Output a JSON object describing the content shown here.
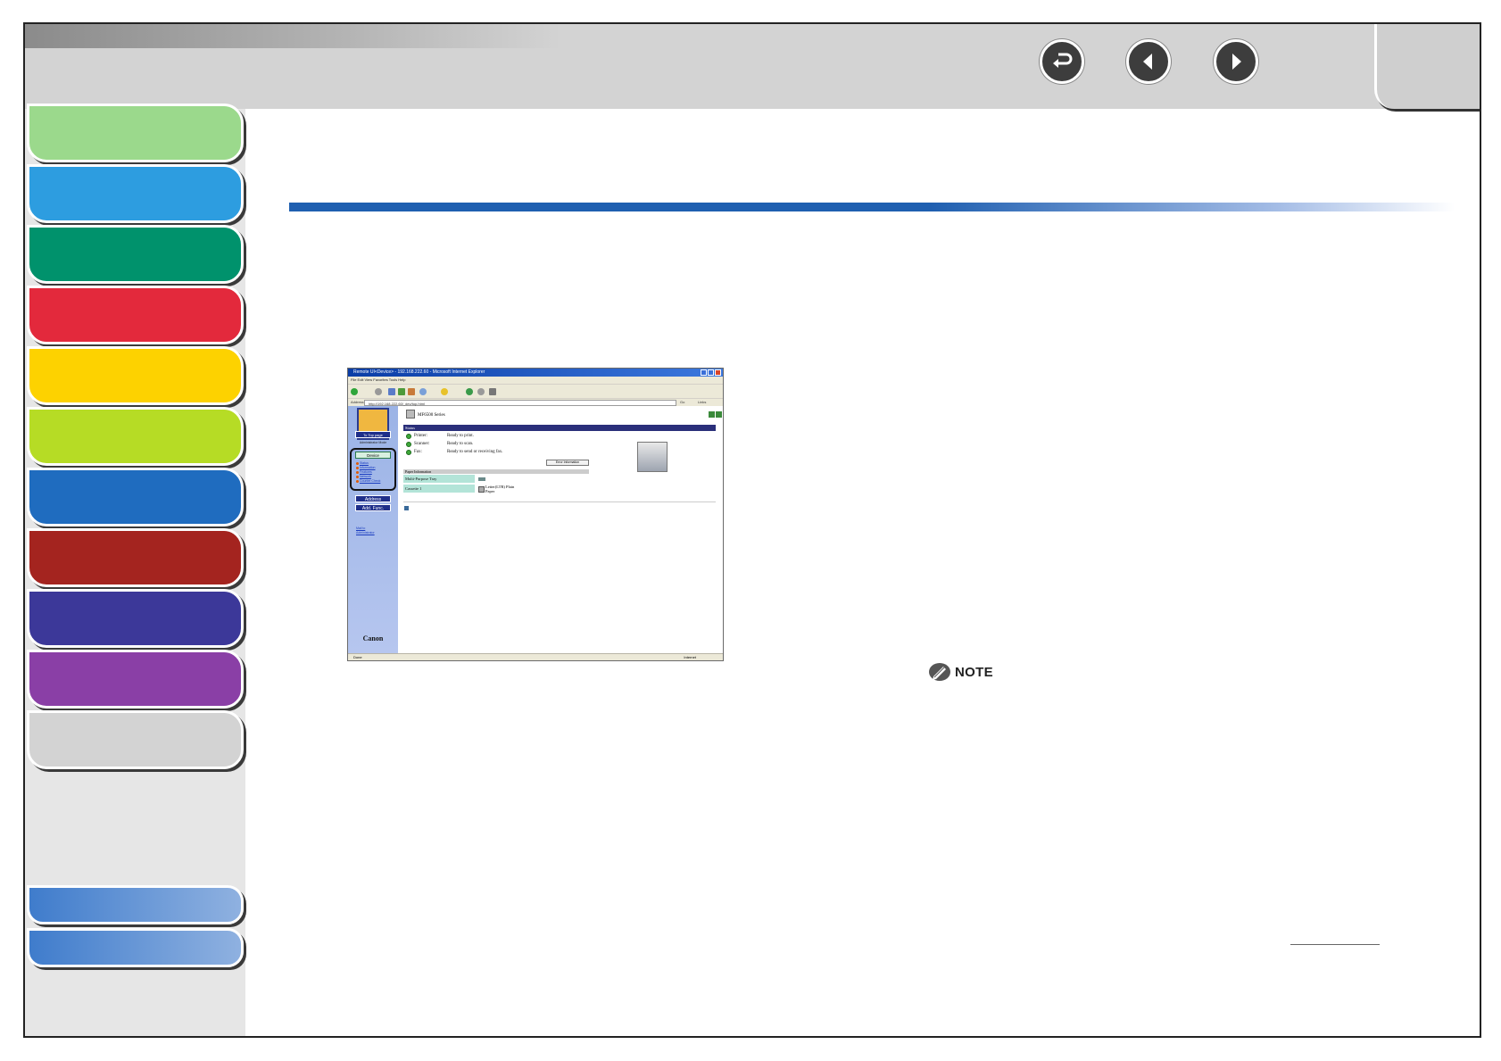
{
  "colors": {
    "chapters": [
      "#9bd98c",
      "#2d9de0",
      "#00926c",
      "#e3293c",
      "#fdd200",
      "#b6dc25",
      "#1f6cbf",
      "#a4241f",
      "#3c3899",
      "#8a3fa6",
      "#d3d3d3"
    ],
    "accent_bar": "#1f5fb0"
  },
  "nav": {
    "back_icon": "return-icon",
    "prev_icon": "previous-page-icon",
    "next_icon": "next-page-icon"
  },
  "screenshot": {
    "window_title": "Remote UI<Device> - 192.168.222.60 - Microsoft Internet Explorer",
    "menu": "File   Edit   View   Favorites   Tools   Help",
    "address_label": "Address",
    "address_url": "http://192.168.222.60/_dev/top.html",
    "go_label": "Go",
    "links_label": "Links",
    "side": {
      "top_page": "To Top page",
      "mode": "Administrator Mode",
      "device_label": "Device",
      "device_links": [
        "Status",
        "Information",
        "Features",
        "Network",
        "Counter Check"
      ],
      "address_button": "Address",
      "add_func_button": "Add. Func.",
      "admin_link": "Mail to Administrator",
      "brand": "Canon"
    },
    "main": {
      "device_name": "MF6500 Series",
      "status_header": "Status",
      "status_rows": [
        {
          "label": "Printer:",
          "value": "Ready to print."
        },
        {
          "label": "Scanner:",
          "value": "Ready to scan."
        },
        {
          "label": "Fax:",
          "value": "Ready to send or receiving fax."
        }
      ],
      "error_button": "Error Information",
      "paper_header": "Paper Information",
      "paper_rows": [
        {
          "source": "Multi-Purpose Tray",
          "paper": ""
        },
        {
          "source": "Cassette 1",
          "paper": "Letter(LTR) Plain Paper"
        }
      ]
    },
    "status_bar": "Done",
    "zone": "Internet"
  },
  "note_label": "NOTE"
}
